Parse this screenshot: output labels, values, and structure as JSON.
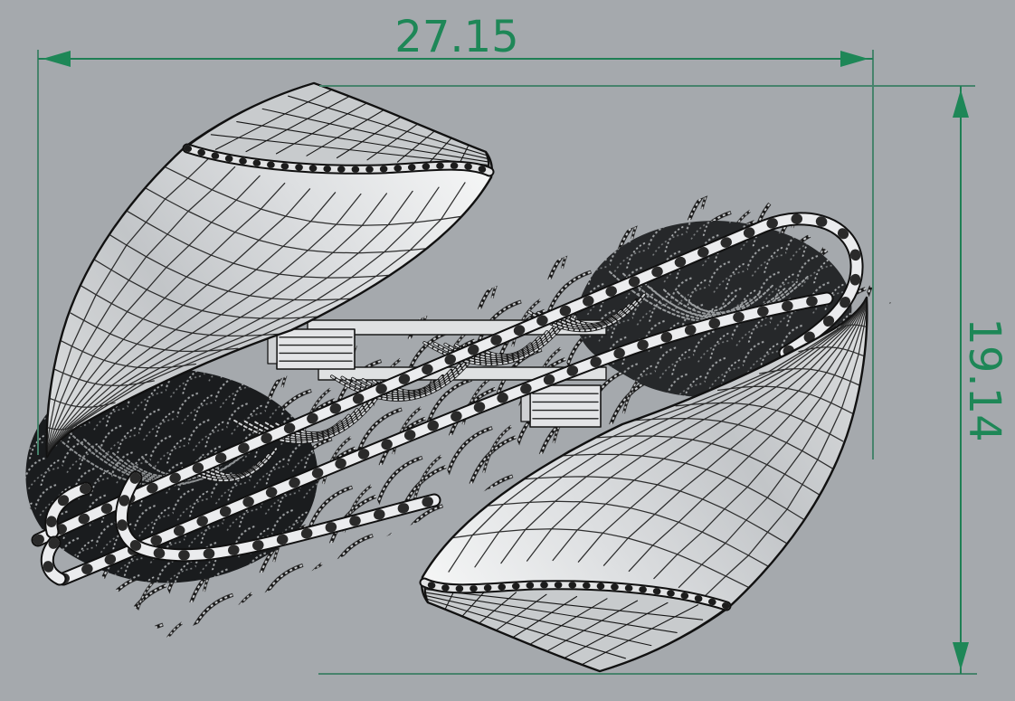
{
  "scene": {
    "background_color": "#a5a9ad",
    "annotation_color": "#1e8757",
    "annotation_line_color": "#47836c"
  },
  "annotations": {
    "width_dimension": {
      "value": "27.15"
    },
    "height_dimension": {
      "value": "19.14"
    }
  }
}
